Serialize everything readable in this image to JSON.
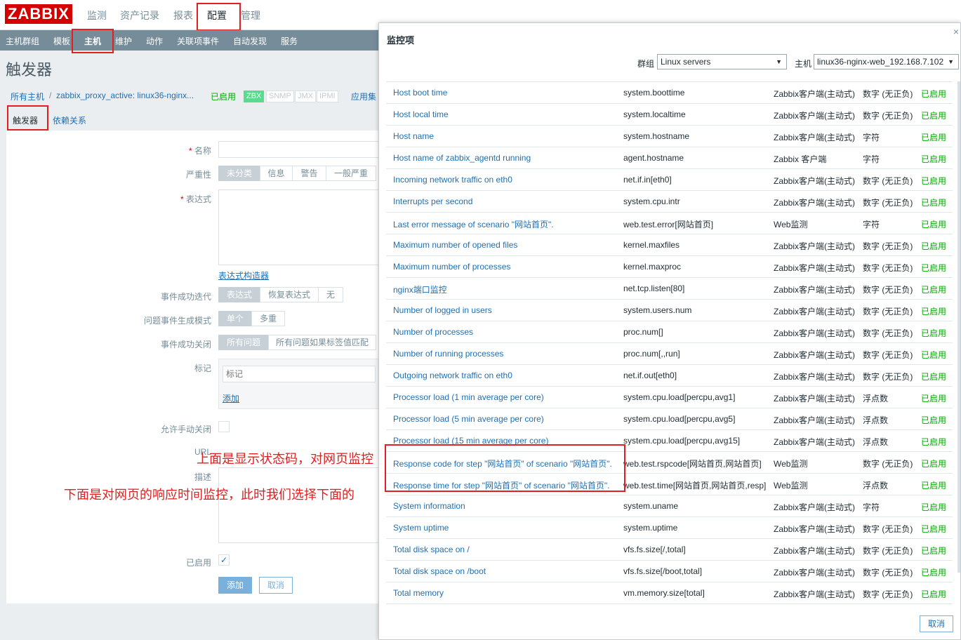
{
  "logo": "ZABBIX",
  "top_menu": [
    "监测",
    "资产记录",
    "报表",
    "配置",
    "管理"
  ],
  "sub_menu": [
    "主机群组",
    "模板",
    "主机",
    "维护",
    "动作",
    "关联项事件",
    "自动发现",
    "服务"
  ],
  "page_title": "触发器",
  "breadcrumb": {
    "all_hosts": "所有主机",
    "sep": "/",
    "host": "zabbix_proxy_active: linux36-nginx...",
    "status": "已启用",
    "apps": "应用集"
  },
  "tags": [
    "ZBX",
    "SNMP",
    "JMX",
    "IPMI"
  ],
  "tabs": [
    "触发器",
    "依赖关系"
  ],
  "form": {
    "name_label": "名称",
    "severity_label": "严重性",
    "severity": [
      "未分类",
      "信息",
      "警告",
      "一般严重"
    ],
    "expr_label": "表达式",
    "expr_builder": "表达式构造器",
    "ok_event_label": "事件成功迭代",
    "ok_event_opts": [
      "表达式",
      "恢复表达式",
      "无"
    ],
    "problem_mode_label": "问题事件生成模式",
    "problem_mode_opts": [
      "单个",
      "多重"
    ],
    "ok_close_label": "事件成功关闭",
    "ok_close_opts": [
      "所有问题",
      "所有问题如果标签值匹配"
    ],
    "tags_label": "标记",
    "tag_placeholder": "标记",
    "add_link": "添加",
    "manual_close_label": "允许手动关闭",
    "url_label": "URL",
    "desc_label": "描述",
    "enabled_label": "已启用",
    "add_btn": "添加",
    "cancel_btn": "取消"
  },
  "annotations": {
    "upper": "上面是显示状态码，对网页监控",
    "lower": "下面是对网页的响应时间监控，此时我们选择下面的"
  },
  "dialog": {
    "title": "监控项",
    "close": "×",
    "group_label": "群组",
    "group_value": "Linux servers",
    "host_label": "主机",
    "host_value": "linux36-nginx-web_192.168.7.102",
    "cancel": "取消",
    "items": [
      {
        "name": "Host boot time",
        "key": "system.boottime",
        "type": "Zabbix客户端(主动式)",
        "value": "数字 (无正负)",
        "status": "已启用"
      },
      {
        "name": "Host local time",
        "key": "system.localtime",
        "type": "Zabbix客户端(主动式)",
        "value": "数字 (无正负)",
        "status": "已启用"
      },
      {
        "name": "Host name",
        "key": "system.hostname",
        "type": "Zabbix客户端(主动式)",
        "value": "字符",
        "status": "已启用"
      },
      {
        "name": "Host name of zabbix_agentd running",
        "key": "agent.hostname",
        "type": "Zabbix 客户端",
        "value": "字符",
        "status": "已启用"
      },
      {
        "name": "Incoming network traffic on eth0",
        "key": "net.if.in[eth0]",
        "type": "Zabbix客户端(主动式)",
        "value": "数字 (无正负)",
        "status": "已启用"
      },
      {
        "name": "Interrupts per second",
        "key": "system.cpu.intr",
        "type": "Zabbix客户端(主动式)",
        "value": "数字 (无正负)",
        "status": "已启用"
      },
      {
        "name": "Last error message of scenario \"网站首页\".",
        "key": "web.test.error[网站首页]",
        "type": "Web监测",
        "value": "字符",
        "status": "已启用"
      },
      {
        "name": "Maximum number of opened files",
        "key": "kernel.maxfiles",
        "type": "Zabbix客户端(主动式)",
        "value": "数字 (无正负)",
        "status": "已启用"
      },
      {
        "name": "Maximum number of processes",
        "key": "kernel.maxproc",
        "type": "Zabbix客户端(主动式)",
        "value": "数字 (无正负)",
        "status": "已启用"
      },
      {
        "name": "nginx端口监控",
        "key": "net.tcp.listen[80]",
        "type": "Zabbix客户端(主动式)",
        "value": "数字 (无正负)",
        "status": "已启用"
      },
      {
        "name": "Number of logged in users",
        "key": "system.users.num",
        "type": "Zabbix客户端(主动式)",
        "value": "数字 (无正负)",
        "status": "已启用"
      },
      {
        "name": "Number of processes",
        "key": "proc.num[]",
        "type": "Zabbix客户端(主动式)",
        "value": "数字 (无正负)",
        "status": "已启用"
      },
      {
        "name": "Number of running processes",
        "key": "proc.num[,,run]",
        "type": "Zabbix客户端(主动式)",
        "value": "数字 (无正负)",
        "status": "已启用"
      },
      {
        "name": "Outgoing network traffic on eth0",
        "key": "net.if.out[eth0]",
        "type": "Zabbix客户端(主动式)",
        "value": "数字 (无正负)",
        "status": "已启用"
      },
      {
        "name": "Processor load (1 min average per core)",
        "key": "system.cpu.load[percpu,avg1]",
        "type": "Zabbix客户端(主动式)",
        "value": "浮点数",
        "status": "已启用"
      },
      {
        "name": "Processor load (5 min average per core)",
        "key": "system.cpu.load[percpu,avg5]",
        "type": "Zabbix客户端(主动式)",
        "value": "浮点数",
        "status": "已启用"
      },
      {
        "name": "Processor load (15 min average per core)",
        "key": "system.cpu.load[percpu,avg15]",
        "type": "Zabbix客户端(主动式)",
        "value": "浮点数",
        "status": "已启用"
      },
      {
        "name": "Response code for step \"网站首页\" of scenario \"网站首页\".",
        "key": "web.test.rspcode[网站首页,网站首页]",
        "type": "Web监测",
        "value": "数字 (无正负)",
        "status": "已启用"
      },
      {
        "name": "Response time for step \"网站首页\" of scenario \"网站首页\".",
        "key": "web.test.time[网站首页,网站首页,resp]",
        "type": "Web监测",
        "value": "浮点数",
        "status": "已启用"
      },
      {
        "name": "System information",
        "key": "system.uname",
        "type": "Zabbix客户端(主动式)",
        "value": "字符",
        "status": "已启用"
      },
      {
        "name": "System uptime",
        "key": "system.uptime",
        "type": "Zabbix客户端(主动式)",
        "value": "数字 (无正负)",
        "status": "已启用"
      },
      {
        "name": "Total disk space on /",
        "key": "vfs.fs.size[/,total]",
        "type": "Zabbix客户端(主动式)",
        "value": "数字 (无正负)",
        "status": "已启用"
      },
      {
        "name": "Total disk space on /boot",
        "key": "vfs.fs.size[/boot,total]",
        "type": "Zabbix客户端(主动式)",
        "value": "数字 (无正负)",
        "status": "已启用"
      },
      {
        "name": "Total memory",
        "key": "vm.memory.size[total]",
        "type": "Zabbix客户端(主动式)",
        "value": "数字 (无正负)",
        "status": "已启用"
      }
    ]
  },
  "colors": {
    "brand": "#d40000",
    "link": "#1f6fb2",
    "enabled": "#00aa00",
    "annotation": "#e02020"
  }
}
